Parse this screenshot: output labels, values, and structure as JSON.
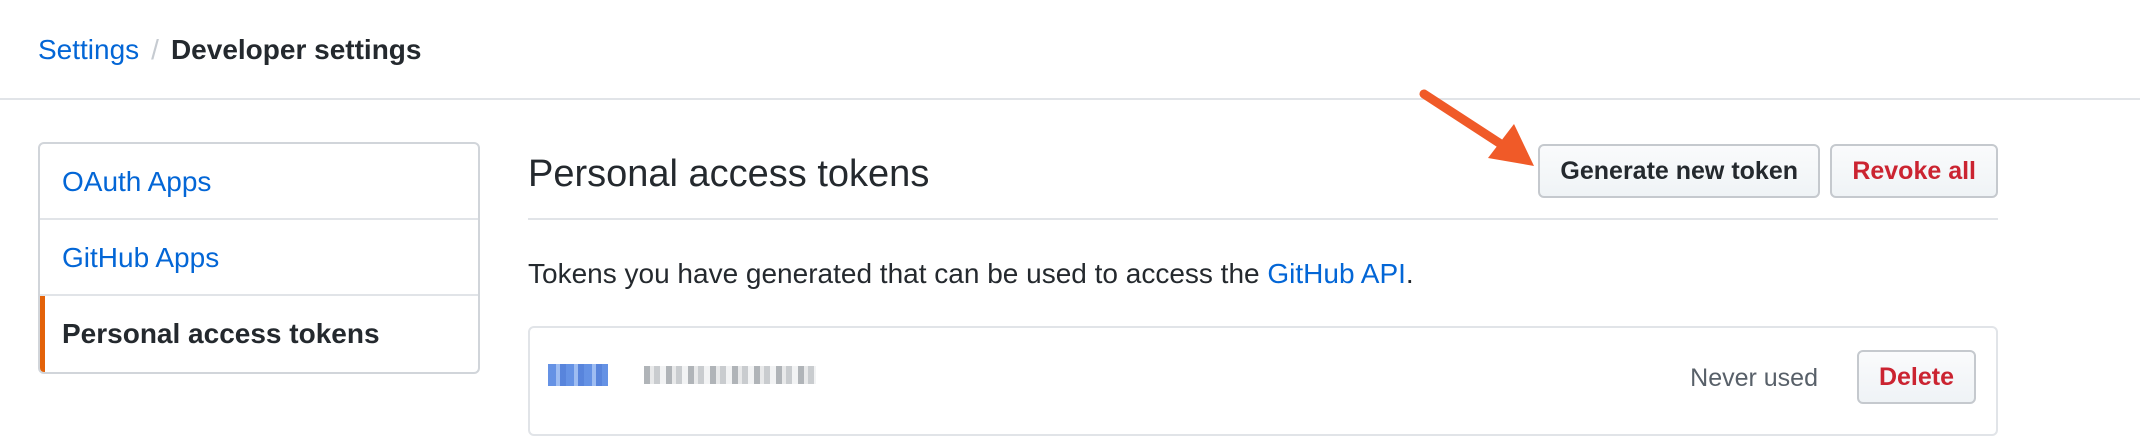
{
  "breadcrumb": {
    "parent": "Settings",
    "separator": "/",
    "current": "Developer settings"
  },
  "sidebar": {
    "items": [
      {
        "label": "OAuth Apps",
        "selected": false
      },
      {
        "label": "GitHub Apps",
        "selected": false
      },
      {
        "label": "Personal access tokens",
        "selected": true
      }
    ]
  },
  "main": {
    "title": "Personal access tokens",
    "generate_button": "Generate new token",
    "revoke_button": "Revoke all",
    "description_prefix": "Tokens you have generated that can be used to access the ",
    "description_link": "GitHub API",
    "description_suffix": "."
  },
  "tokens": [
    {
      "usage": "Never used",
      "delete_label": "Delete"
    }
  ],
  "colors": {
    "link": "#0366d6",
    "danger": "#cb2431",
    "selected_indicator": "#e36209",
    "annotation_arrow": "#f05a28"
  }
}
